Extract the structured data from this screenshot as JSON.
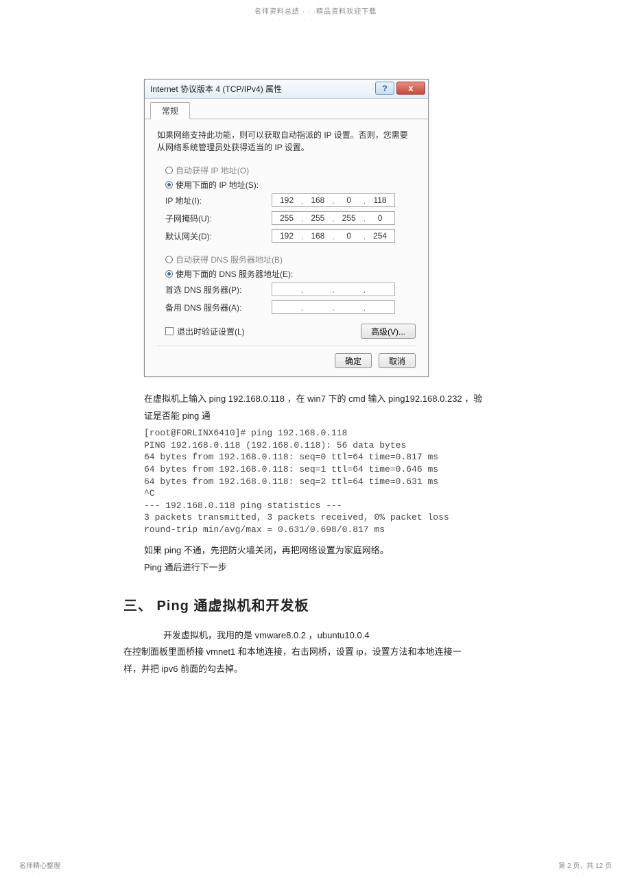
{
  "header": {
    "text": "名师资料总结 · · ·精品资料欢迎下载",
    "dots": "· · · · · · · · · · · · · · · · · ·"
  },
  "dialog": {
    "title": "Internet 协议版本 4 (TCP/IPv4) 属性",
    "help_icon": "?",
    "close_icon": "x",
    "tab_general": "常规",
    "intro": "如果网络支持此功能，则可以获取自动指派的 IP 设置。否则，您需要从网络系统管理员处获得适当的 IP 设置。",
    "radio_auto_ip": "自动获得 IP 地址(O)",
    "radio_manual_ip": "使用下面的 IP 地址(S):",
    "label_ip": "IP 地址(I):",
    "label_mask": "子网掩码(U):",
    "label_gateway": "默认网关(D):",
    "ip": {
      "a": "192",
      "b": "168",
      "c": "0",
      "d": "118"
    },
    "mask": {
      "a": "255",
      "b": "255",
      "c": "255",
      "d": "0"
    },
    "gateway": {
      "a": "192",
      "b": "168",
      "c": "0",
      "d": "254"
    },
    "radio_auto_dns": "自动获得 DNS 服务器地址(B)",
    "radio_manual_dns": "使用下面的 DNS 服务器地址(E):",
    "label_dns1": "首选 DNS 服务器(P):",
    "label_dns2": "备用 DNS 服务器(A):",
    "checkbox_exit": "退出时验证设置(L)",
    "btn_advanced": "高级(V)...",
    "btn_ok": "确定",
    "btn_cancel": "取消"
  },
  "body": {
    "para1a": "在虚拟机上输入   ping 192.168.0.118 ，在  win7 下的  cmd 输入  ping192.168.0.232 ，验",
    "para1b": "证是否能  ping 通",
    "terminal": "[root@FORLINX6410]# ping 192.168.0.118\nPING 192.168.0.118 (192.168.0.118): 56 data bytes\n64 bytes from 192.168.0.118: seq=0 ttl=64 time=0.817 ms\n64 bytes from 192.168.0.118: seq=1 ttl=64 time=0.646 ms\n64 bytes from 192.168.0.118: seq=2 ttl=64 time=0.631 ms\n^C\n--- 192.168.0.118 ping statistics ---\n3 packets transmitted, 3 packets received, 0% packet loss\nround-trip min/avg/max = 0.631/0.698/0.817 ms",
    "para2": "如果  ping 不通，先把防火墙关闭，再把网络设置为家庭网络。",
    "para3": "Ping 通后进行下一步",
    "heading": "三、   Ping 通虚拟机和开发板",
    "para4": "开发虚拟机，我用的是    vmware8.0.2 ，ubuntu10.0.4",
    "para5": "在控制面板里面桥接   vmnet1 和本地连接，右击网桥，设置    ip，设置方法和本地连接一",
    "para6": "样，并把  ipv6 前面的勾去掉。"
  },
  "footer": {
    "left": "名师精心整理",
    "left_dots": "· · · · · · ·",
    "right": "第 2 页，共 12 页",
    "right_dots": "· · · · · · · · ·"
  }
}
